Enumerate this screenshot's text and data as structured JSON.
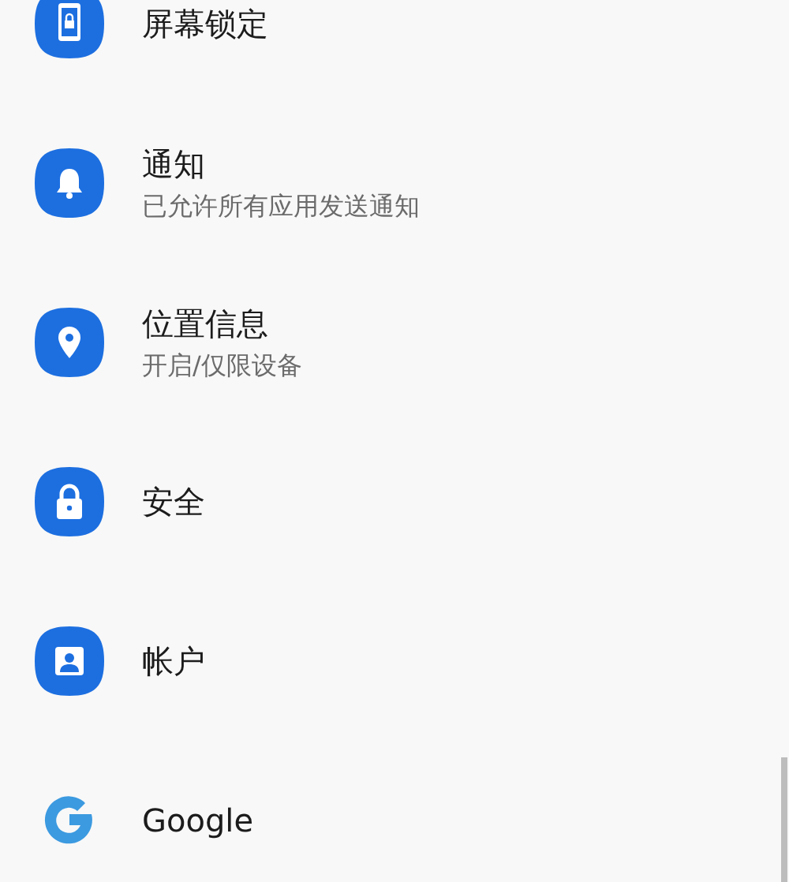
{
  "settings": [
    {
      "title": "屏幕锁定"
    },
    {
      "title": "通知",
      "subtitle": "已允许所有应用发送通知"
    },
    {
      "title": "位置信息",
      "subtitle": "开启/仅限设备"
    },
    {
      "title": "安全"
    },
    {
      "title": "帐户"
    },
    {
      "title": "Google"
    }
  ]
}
